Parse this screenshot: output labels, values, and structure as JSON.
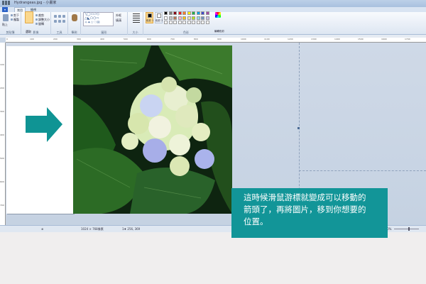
{
  "window": {
    "title": "Hydrangeas.jpg - 小畫家",
    "tabs": {
      "file": "▾",
      "home": "常用",
      "view": "檢視"
    }
  },
  "ribbon": {
    "clipboard": {
      "paste": "貼上",
      "cut": "剪下",
      "copy": "複製",
      "label": "剪貼簿"
    },
    "image": {
      "select": "選取",
      "crop": "裁剪",
      "resize": "調整大小",
      "rotate": "旋轉",
      "label": "影像"
    },
    "tools": {
      "label": "工具"
    },
    "brushes": {
      "label": "筆刷"
    },
    "shapes": {
      "outline": "外框",
      "fill": "填滿",
      "label": "圖形"
    },
    "size": {
      "label": "大小"
    },
    "colors": {
      "color1": "色彩 1",
      "color2": "色彩 2",
      "edit": "編輯色彩",
      "label": "色彩",
      "palette": [
        "#000000",
        "#7f7f7f",
        "#880015",
        "#ed1c24",
        "#ff7f27",
        "#fff200",
        "#22b14c",
        "#00a2e8",
        "#3f48cc",
        "#a349a4",
        "#ffffff",
        "#c3c3c3",
        "#b97a57",
        "#ffaec9",
        "#ffc90e",
        "#efe4b0",
        "#b5e61d",
        "#99d9ea",
        "#7092be",
        "#c8bfe7",
        "#ffffff",
        "#ffffff",
        "#ffffff",
        "#ffffff",
        "#ffffff",
        "#ffffff",
        "#ffffff",
        "#ffffff",
        "#ffffff",
        "#ffffff"
      ]
    }
  },
  "ruler": {
    "top": [
      "0",
      "100",
      "200",
      "300",
      "400",
      "500",
      "600",
      "700",
      "800",
      "900",
      "1000",
      "1100",
      "1200",
      "1300",
      "1400",
      "1500",
      "1600",
      "1700"
    ],
    "left": [
      "100",
      "200",
      "300",
      "400",
      "500",
      "600",
      "700"
    ]
  },
  "status": {
    "size": "1024 × 768像素",
    "selection": "1♦ 256, 369",
    "zoom": "100%"
  },
  "colors": {
    "accent": "#129598",
    "arrow": "#0f9494"
  },
  "callout": {
    "line1": "這時候滑鼠游標就變成可以移動的",
    "line2": "箭頭了，再將圖片，移到你想要的",
    "line3": "位置。"
  }
}
